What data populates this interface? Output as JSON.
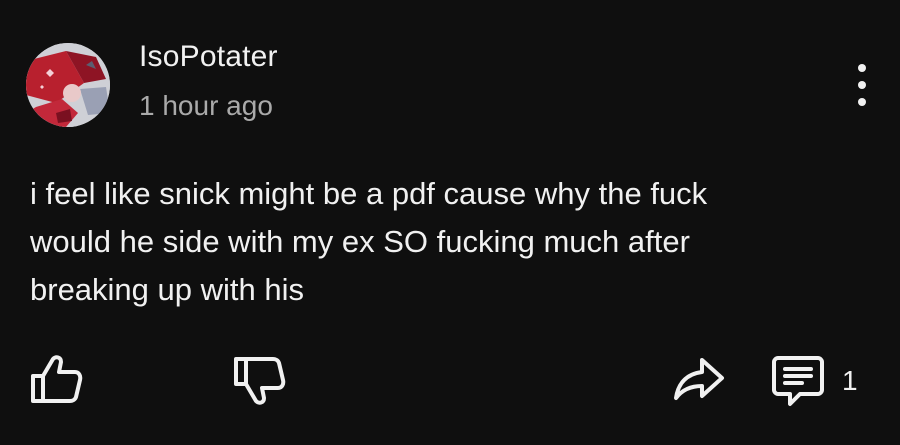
{
  "comment": {
    "author": "IsoPotater",
    "timestamp": "1 hour ago",
    "text": "i feel like snick might be a pdf cause why the fuck\nwould he side with my ex SO fucking much after\nbreaking up with his",
    "reply_count": "1"
  },
  "icons": {
    "avatar": "avatar-image",
    "more": "more-vert-icon",
    "like": "thumbs-up-icon",
    "dislike": "thumbs-down-icon",
    "share": "share-arrow-icon",
    "reply": "comment-bubble-icon"
  },
  "colors": {
    "background": "#0f0f0f",
    "text_primary": "#f1f1f1",
    "text_secondary": "#aaaaaa"
  }
}
